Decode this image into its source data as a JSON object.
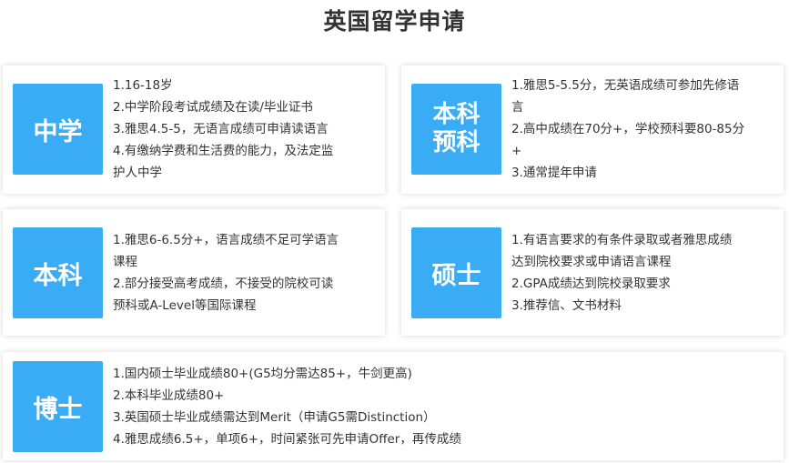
{
  "page": {
    "title": "英国留学申请"
  },
  "sections": [
    {
      "badge": "中学",
      "lines": [
        "1.16-18岁",
        "2.中学阶段考试成绩及在读/毕业证书",
        "3.雅思4.5-5，无语言成绩可申请读语言",
        "4.有缴纳学费和生活费的能力，及法定监",
        "护人中学"
      ]
    },
    {
      "badge": "本科\n预科",
      "lines": [
        "1.雅思5-5.5分，无英语成绩可参加先修语",
        "言",
        "2.高中成绩在70分+，学校预科要80-85分",
        "+",
        "3.通常提年申请"
      ]
    },
    {
      "badge": "本科",
      "lines": [
        "1.雅思6-6.5分+，语言成绩不足可学语言",
        "课程",
        "2.部分接受高考成绩，不接受的院校可读",
        "预科或A-Level等国际课程"
      ]
    },
    {
      "badge": "硕士",
      "lines": [
        "1.有语言要求的有条件录取或者雅思成绩",
        "达到院校要求或申请语言课程",
        "2.GPA成绩达到院校录取要求",
        "3.推荐信、文书材料"
      ]
    },
    {
      "badge": "博士",
      "lines": [
        "1.国内硕士毕业成绩80+(G5均分需达85+，牛剑更高)",
        "2.本科毕业成绩80+",
        "3.英国硕士毕业成绩需达到Merit（申请G5需Distinction）",
        "4.雅思成绩6.5+，单项6+，时间紧张可先申请Offer，再传成绩"
      ]
    }
  ]
}
